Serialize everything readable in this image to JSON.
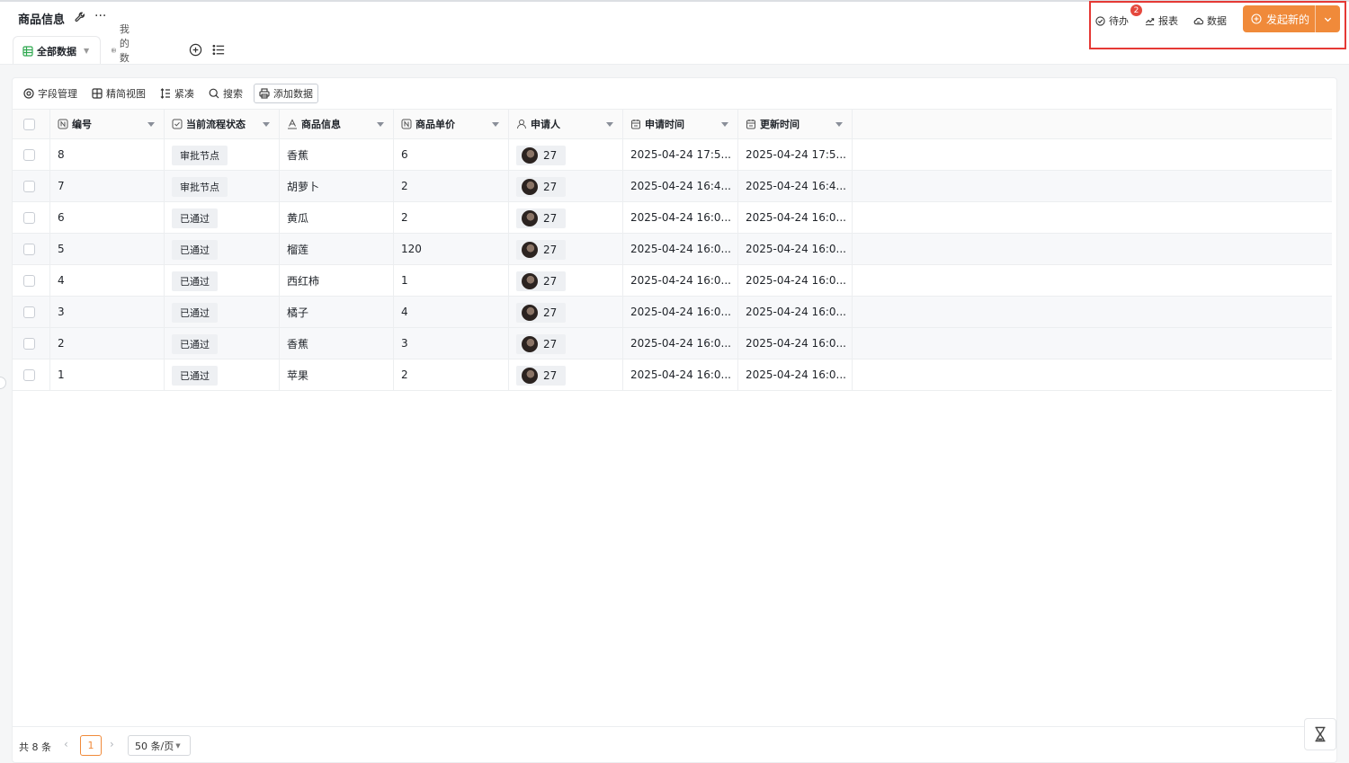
{
  "header": {
    "title": "商品信息",
    "settings_icon": "wrench-icon",
    "more_label": "···"
  },
  "views": {
    "tabs": [
      {
        "label": "全部数据",
        "icon": "grid-icon",
        "active": true
      },
      {
        "label": "我的数据",
        "icon": "grid-icon",
        "active": false
      }
    ]
  },
  "actions": {
    "todo_label": "待办",
    "todo_badge": "2",
    "report_label": "报表",
    "data_label": "数据",
    "primary_label": "发起新的",
    "accent_color": "#f08a3a"
  },
  "toolbar": {
    "field_manage": "字段管理",
    "simple_view": "精简视图",
    "compact": "紧凑",
    "search": "搜索",
    "add_data": "添加数据"
  },
  "table": {
    "columns": [
      {
        "label": "编号",
        "icon": "number-field-icon"
      },
      {
        "label": "当前流程状态",
        "icon": "status-field-icon"
      },
      {
        "label": "商品信息",
        "icon": "text-field-icon"
      },
      {
        "label": "商品单价",
        "icon": "number-field-icon"
      },
      {
        "label": "申请人",
        "icon": "user-field-icon"
      },
      {
        "label": "申请时间",
        "icon": "date-field-icon"
      },
      {
        "label": "更新时间",
        "icon": "date-field-icon"
      }
    ],
    "rows": [
      {
        "id": "8",
        "status": "审批节点",
        "product": "香蕉",
        "price": "6",
        "applicant": "27",
        "apply_time": "2025-04-24 17:5...",
        "update_time": "2025-04-24 17:5..."
      },
      {
        "id": "7",
        "status": "审批节点",
        "product": "胡萝卜",
        "price": "2",
        "applicant": "27",
        "apply_time": "2025-04-24 16:4...",
        "update_time": "2025-04-24 16:4..."
      },
      {
        "id": "6",
        "status": "已通过",
        "product": "黄瓜",
        "price": "2",
        "applicant": "27",
        "apply_time": "2025-04-24 16:0...",
        "update_time": "2025-04-24 16:0..."
      },
      {
        "id": "5",
        "status": "已通过",
        "product": "榴莲",
        "price": "120",
        "applicant": "27",
        "apply_time": "2025-04-24 16:0...",
        "update_time": "2025-04-24 16:0..."
      },
      {
        "id": "4",
        "status": "已通过",
        "product": "西红柿",
        "price": "1",
        "applicant": "27",
        "apply_time": "2025-04-24 16:0...",
        "update_time": "2025-04-24 16:0..."
      },
      {
        "id": "3",
        "status": "已通过",
        "product": "橘子",
        "price": "4",
        "applicant": "27",
        "apply_time": "2025-04-24 16:0...",
        "update_time": "2025-04-24 16:0..."
      },
      {
        "id": "2",
        "status": "已通过",
        "product": "香蕉",
        "price": "3",
        "applicant": "27",
        "apply_time": "2025-04-24 16:0...",
        "update_time": "2025-04-24 16:0..."
      },
      {
        "id": "1",
        "status": "已通过",
        "product": "苹果",
        "price": "2",
        "applicant": "27",
        "apply_time": "2025-04-24 16:0...",
        "update_time": "2025-04-24 16:0..."
      }
    ]
  },
  "pagination": {
    "total_label": "共 8 条",
    "current_page": "1",
    "page_size": "50 条/页"
  }
}
